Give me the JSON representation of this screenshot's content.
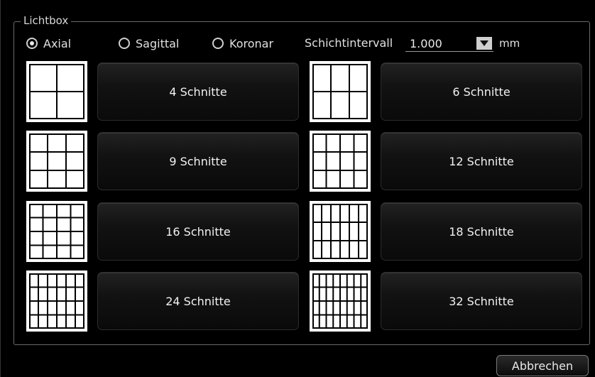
{
  "group": {
    "title": "Lichtbox"
  },
  "orientation": {
    "options": [
      {
        "label": "Axial",
        "checked": true
      },
      {
        "label": "Sagittal",
        "checked": false
      },
      {
        "label": "Koronar",
        "checked": false
      }
    ]
  },
  "interval": {
    "label": "Schichtintervall",
    "value": "1.000",
    "unit": "mm"
  },
  "layouts": [
    {
      "label": "4 Schnitte",
      "cols": 2,
      "rows": 2
    },
    {
      "label": "6 Schnitte",
      "cols": 3,
      "rows": 2
    },
    {
      "label": "9 Schnitte",
      "cols": 3,
      "rows": 3
    },
    {
      "label": "12 Schnitte",
      "cols": 4,
      "rows": 3
    },
    {
      "label": "16 Schnitte",
      "cols": 4,
      "rows": 4
    },
    {
      "label": "18 Schnitte",
      "cols": 6,
      "rows": 3
    },
    {
      "label": "24 Schnitte",
      "cols": 6,
      "rows": 4
    },
    {
      "label": "32 Schnitte",
      "cols": 8,
      "rows": 4
    }
  ],
  "footer": {
    "cancel_label": "Abbrechen"
  }
}
